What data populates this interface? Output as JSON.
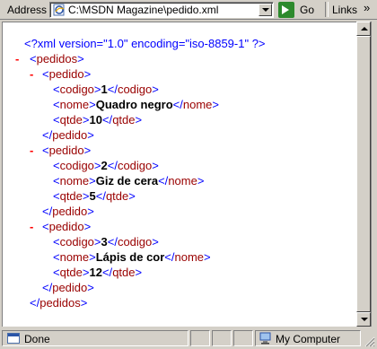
{
  "address_bar": {
    "label": "Address",
    "url": "C:\\MSDN Magazine\\pedido.xml",
    "go_label": "Go",
    "links_label": "Links",
    "links_chevron": "»"
  },
  "xml": {
    "declaration": "<?xml version=\"1.0\" encoding=\"iso-8859-1\" ?>",
    "root": "pedidos",
    "item": "pedido",
    "fields": [
      "codigo",
      "nome",
      "qtde"
    ],
    "toggle_glyph": "-",
    "records": [
      {
        "codigo": "1",
        "nome": "Quadro negro",
        "qtde": "10"
      },
      {
        "codigo": "2",
        "nome": "Giz de cera",
        "qtde": "5"
      },
      {
        "codigo": "3",
        "nome": "Lápis de cor",
        "qtde": "12"
      }
    ]
  },
  "status_bar": {
    "status": "Done",
    "zone": "My Computer"
  },
  "colors": {
    "tag_markup": "#0000ff",
    "tag_name": "#990000",
    "toggle": "#ff0000",
    "chrome": "#d4d0c8"
  }
}
